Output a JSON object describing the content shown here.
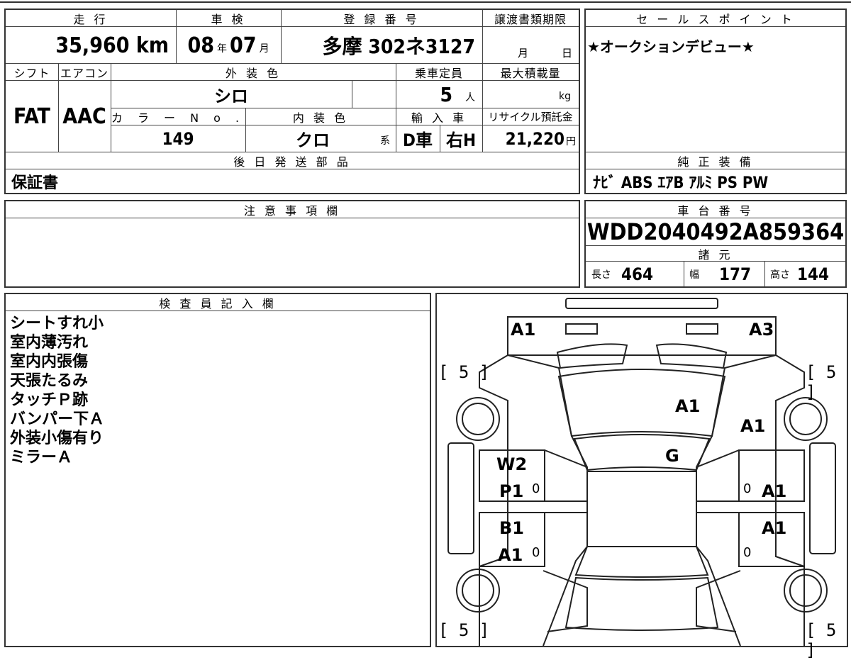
{
  "labels": {
    "mileage": "走 行",
    "inspection": "車 検",
    "registration": "登 録 番 号",
    "transfer_deadline": "譲渡書類期限",
    "sales_point": "セ ー ル ス ポ イ ン ト",
    "shift": "シフト",
    "aircon": "エアコン",
    "exterior_color": "外 装 色",
    "capacity": "乗車定員",
    "max_load": "最大積載量",
    "color_no": "カ ラ ー N o .",
    "interior_color": "内 装 色",
    "import": "輸 入 車",
    "recycle": "リサイクル預託金",
    "later_parts": "後 日 発 送 部 品",
    "genuine_equipment": "純 正 装 備",
    "caution": "注 意 事 項 欄",
    "chassis_no_label": "車 台 番 号",
    "specs": "諸 元",
    "inspector": "検 査 員 記 入 欄"
  },
  "vehicle": {
    "mileage": "35,960",
    "mileage_unit": "km",
    "inspection_year": "08",
    "year_unit": "年",
    "inspection_month": "07",
    "month_unit": "月",
    "registration_no": "多摩 302ネ3127",
    "deadline_month": "月",
    "deadline_day": "日",
    "shift": "FAT",
    "aircon": "AAC",
    "exterior_color": "シロ",
    "capacity": "5",
    "capacity_unit": "人",
    "load_unit": "kg",
    "color_no": "149",
    "interior_color": "クロ",
    "interior_suffix": "系",
    "import_type": "D車",
    "steering": "右H",
    "recycle_fee": "21,220",
    "yen": "円",
    "later_parts": "保証書",
    "sales_point": "★オークションデビュー★",
    "equipment": "ﾅﾋﾞ ABS ｴｱB ｱﾙﾐ PS PW",
    "chassis_no": "WDD2040492A859364",
    "length_label": "長さ",
    "length": "464",
    "width_label": "幅",
    "width": "177",
    "height_label": "高さ",
    "height": "144"
  },
  "inspector_notes": [
    "シートすれ小",
    "室内薄汚れ",
    "室内内張傷",
    "天張たるみ",
    "タッチＰ跡",
    "バンパー下Ａ",
    "外装小傷有り",
    "ミラーＡ"
  ],
  "diagram": {
    "front_left_bumper": "A1",
    "front_right_bumper": "A3",
    "hood": "A1",
    "front_right_fender": "A1",
    "windshield": "G",
    "left_front_door_1": "W2",
    "left_front_door_2": "P1",
    "left_rear_door_1": "B1",
    "left_rear_door_2": "A1",
    "right_front_door": "A1",
    "right_rear_door": "A1",
    "tire_fl": "[ 5 ]",
    "tire_fr": "[ 5 ]",
    "tire_rl": "[ 5 ]",
    "tire_rr": "[ 5 ]",
    "zero": "0"
  }
}
